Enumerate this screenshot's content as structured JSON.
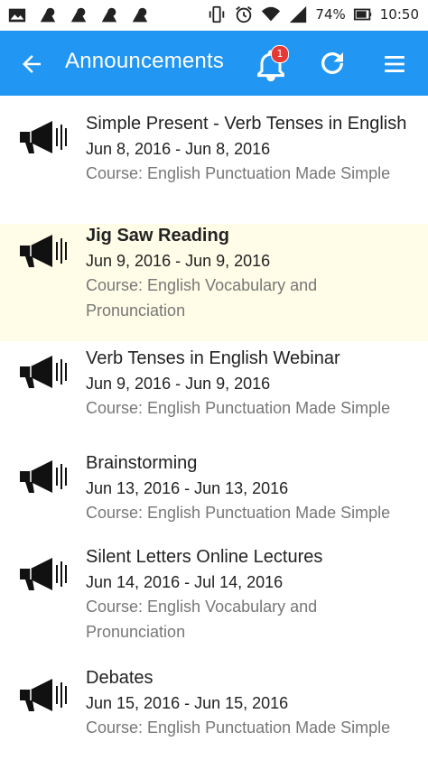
{
  "status_bar": {
    "battery": "74%",
    "time": "10:50",
    "icons": [
      "gallery-icon",
      "notification-icon",
      "notification-icon",
      "notification-icon",
      "notification-icon",
      "vibrate-icon",
      "alarm-icon",
      "wifi-icon",
      "signal-icon",
      "battery-icon"
    ]
  },
  "app_bar": {
    "title": "Announcements",
    "badge_count": "1",
    "color": "#2196f3"
  },
  "announcements": [
    {
      "title": "Simple Present - Verb Tenses in English",
      "dates": "Jun 8, 2016 - Jun 8, 2016",
      "course": "Course: English Punctuation Made Simple",
      "unread": false
    },
    {
      "title": "Jig Saw Reading",
      "dates": "Jun 9, 2016 - Jun 9, 2016",
      "course": "Course: English Vocabulary and Pronunciation",
      "unread": true
    },
    {
      "title": "Verb Tenses in English Webinar",
      "dates": "Jun 9, 2016 - Jun 9, 2016",
      "course": "Course: English Punctuation Made Simple",
      "unread": false
    },
    {
      "title": "Brainstorming",
      "dates": "Jun 13, 2016 - Jun 13, 2016",
      "course": "Course: English Punctuation Made Simple",
      "unread": false
    },
    {
      "title": "Silent Letters Online Lectures",
      "dates": "Jun 14, 2016 - Jul 14, 2016",
      "course": "Course: English Vocabulary and Pronunciation",
      "unread": false
    },
    {
      "title": "Debates",
      "dates": "Jun 15, 2016 - Jun 15, 2016",
      "course": "Course: English Punctuation Made Simple",
      "unread": false
    }
  ]
}
